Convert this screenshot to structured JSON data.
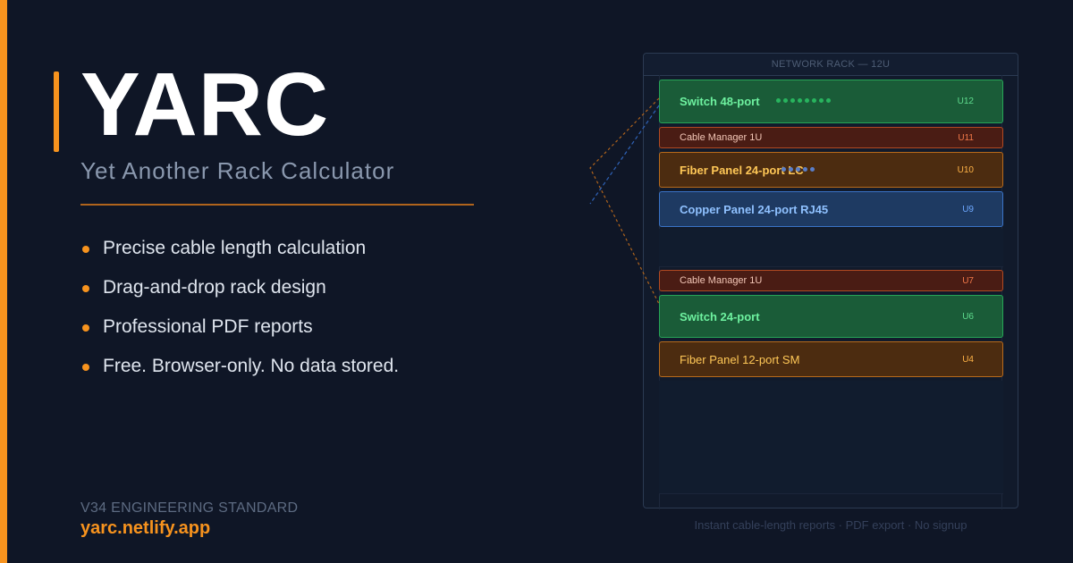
{
  "brand": {
    "title": "YARC",
    "subtitle": "Yet Another Rack Calculator",
    "accent_color": "#f7931e"
  },
  "features": [
    "Precise cable length calculation",
    "Drag-and-drop rack design",
    "Professional PDF reports",
    "Free. Browser-only. No data stored."
  ],
  "footer": {
    "standard": "V34 ENGINEERING STANDARD",
    "site": "yarc.netlify.app"
  },
  "rack": {
    "header": "NETWORK RACK — 12U",
    "units": [
      {
        "label": "Switch 48-port",
        "u": "U12",
        "kind": "switch"
      },
      {
        "label": "Cable Manager 1U",
        "u": "U11",
        "kind": "cable-manager"
      },
      {
        "label": "Fiber Panel 24-port LC",
        "u": "U10",
        "kind": "fiber"
      },
      {
        "label": "Copper Panel 24-port RJ45",
        "u": "U9",
        "kind": "copper"
      },
      {
        "label": "Cable Manager 1U",
        "u": "U7",
        "kind": "cable-manager"
      },
      {
        "label": "Switch 24-port",
        "u": "U6",
        "kind": "switch"
      },
      {
        "label": "Fiber Panel 12-port SM",
        "u": "U4",
        "kind": "fiber"
      }
    ],
    "tagline": "Instant cable-length reports · PDF export · No signup"
  }
}
